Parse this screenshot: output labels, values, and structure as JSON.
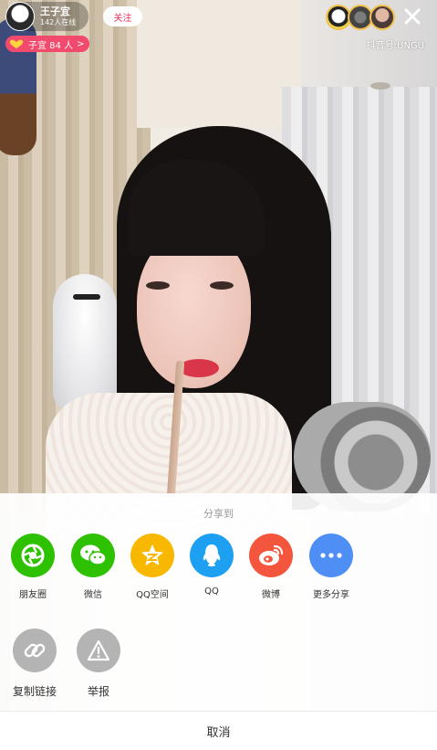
{
  "host": {
    "name": "王子宜",
    "online": "142人在线",
    "follow_label": "关注",
    "fan_group": {
      "label": "子宜 84 人",
      "chevron": ">"
    },
    "douyin_id": "抖音号:UNGU"
  },
  "viewers": [
    {
      "icon": "viewer-avatar-1"
    },
    {
      "icon": "viewer-avatar-2"
    },
    {
      "icon": "viewer-avatar-3"
    }
  ],
  "share_sheet": {
    "title": "分享到",
    "targets": [
      {
        "label": "朋友圈",
        "icon": "moments-icon",
        "color": "#2dc100"
      },
      {
        "label": "微信",
        "icon": "wechat-icon",
        "color": "#2dc100"
      },
      {
        "label": "QQ空间",
        "icon": "qzone-icon",
        "color": "#f8b800"
      },
      {
        "label": "QQ",
        "icon": "qq-icon",
        "color": "#1ea0f2"
      },
      {
        "label": "微博",
        "icon": "weibo-icon",
        "color": "#f4563d"
      },
      {
        "label": "更多分享",
        "icon": "more-icon",
        "color": "#4f8ff5"
      }
    ],
    "actions": [
      {
        "label": "复制链接",
        "icon": "link-icon"
      },
      {
        "label": "举报",
        "icon": "warning-icon"
      }
    ],
    "cancel_label": "取消"
  },
  "colors": {
    "follow_text": "#e8325a",
    "fan_pill": "#f14a6d",
    "viewer_ring": "#f2c14a",
    "action_gray": "#b4b4b4"
  }
}
